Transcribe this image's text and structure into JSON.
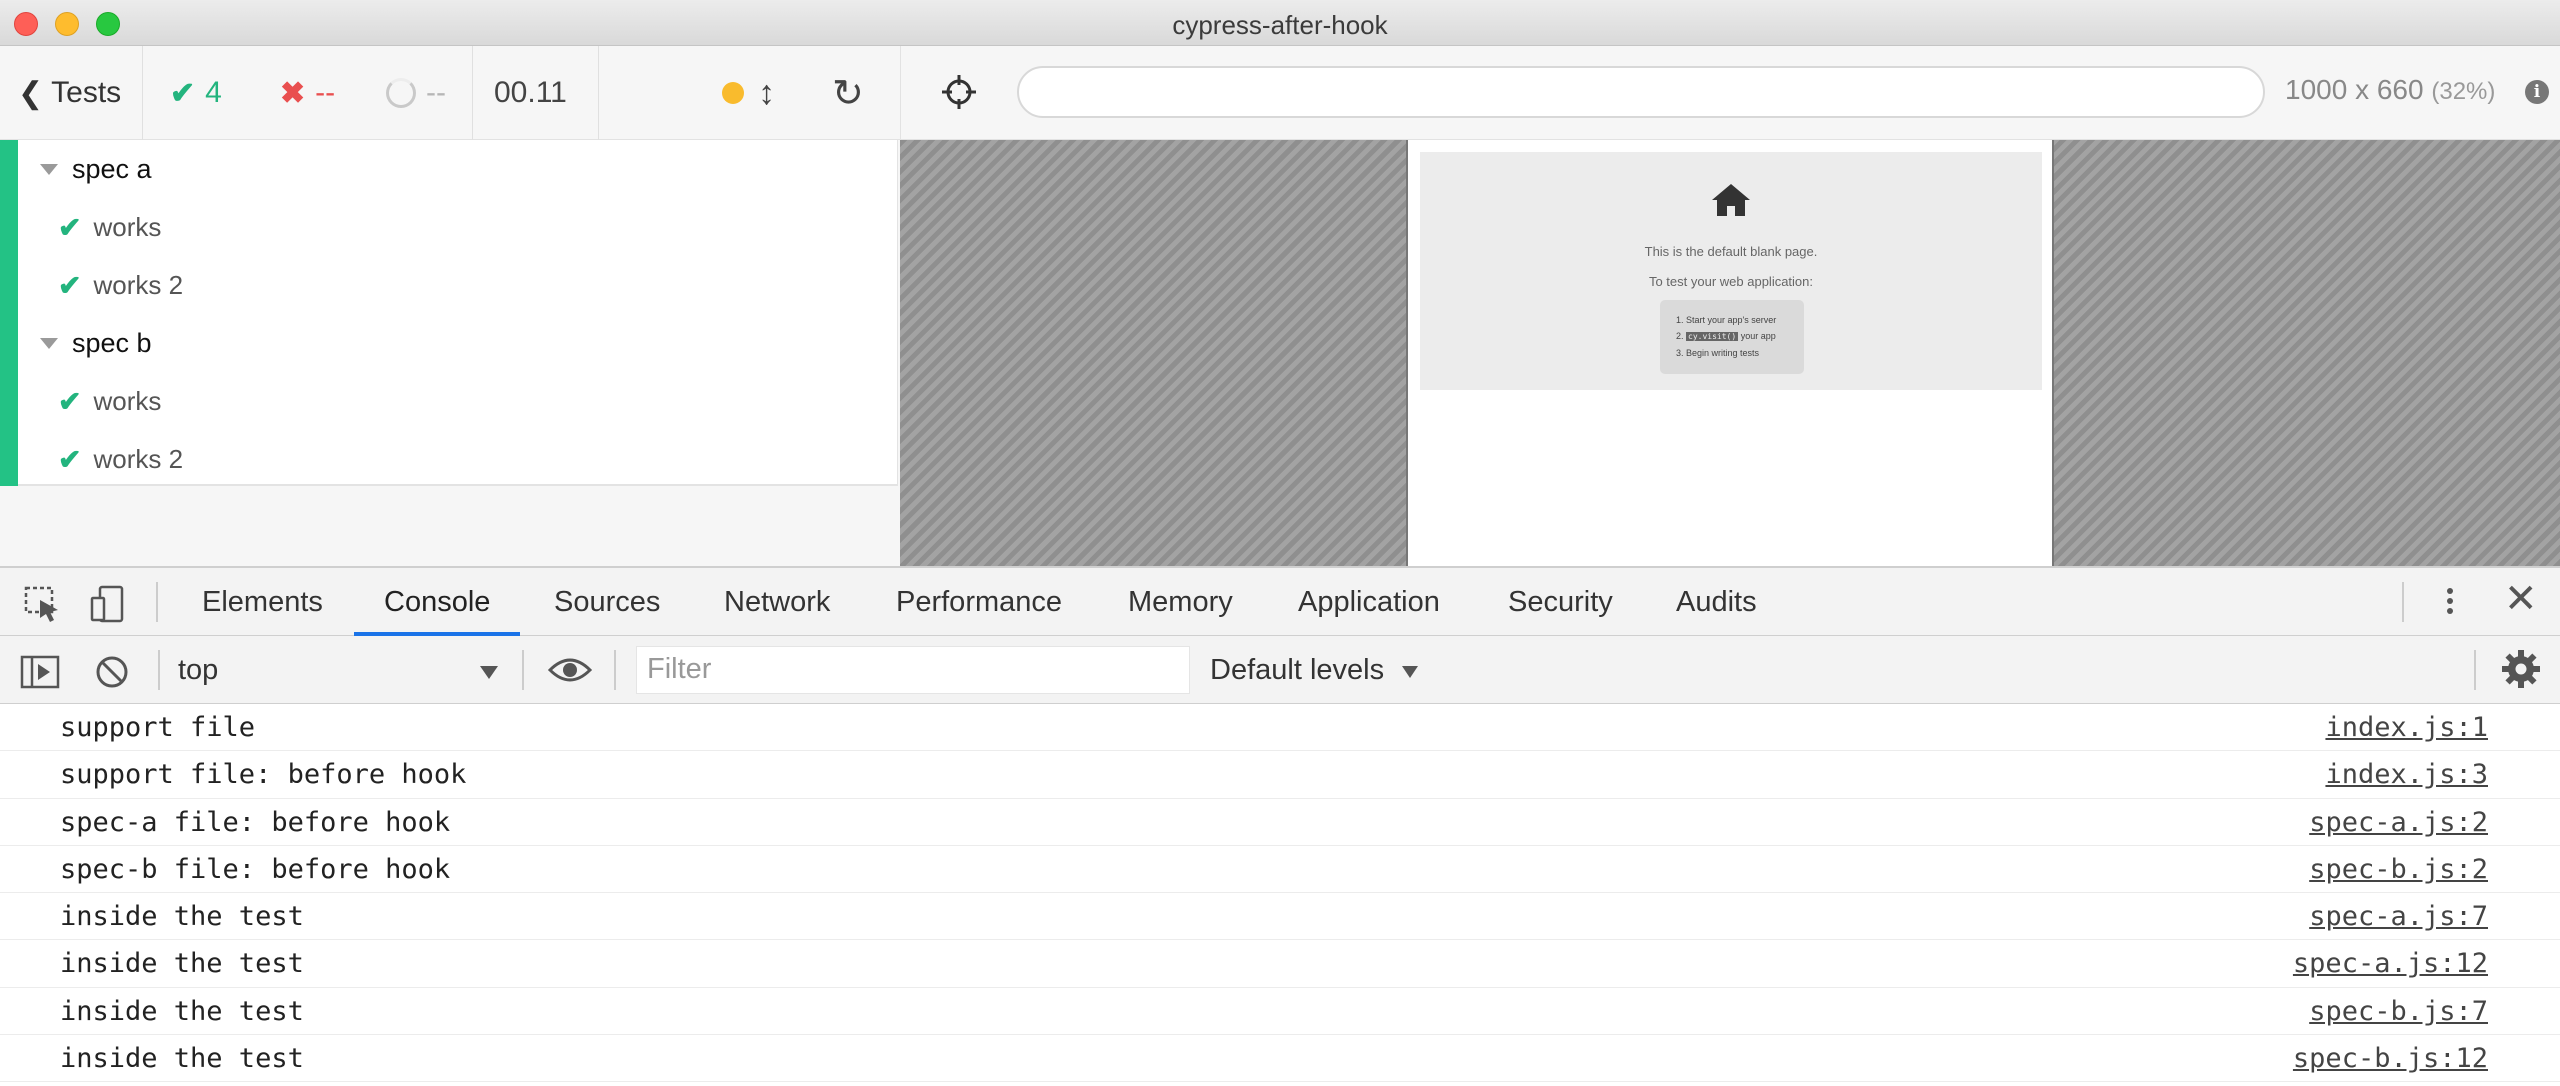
{
  "window": {
    "title": "cypress-after-hook"
  },
  "reporter": {
    "tests_label": "Tests",
    "passed_count": "4",
    "failed_count": "--",
    "pending_count": "--",
    "duration": "00.11",
    "suites": [
      {
        "title": "spec a",
        "tests": [
          {
            "title": "works"
          },
          {
            "title": "works 2"
          }
        ]
      },
      {
        "title": "spec b",
        "tests": [
          {
            "title": "works"
          },
          {
            "title": "works 2"
          }
        ]
      }
    ]
  },
  "aut": {
    "url": "",
    "viewport": "1000 x 660",
    "scale": "(32%)",
    "blank_page": {
      "line1": "This is the default blank page.",
      "line2": "To test your web application:",
      "step1": "1. Start your app's server",
      "step2_prefix": "2. ",
      "step2_code": "cy.visit()",
      "step2_suffix": " your app",
      "step3": "3. Begin writing tests"
    }
  },
  "devtools": {
    "tabs": [
      "Elements",
      "Console",
      "Sources",
      "Network",
      "Performance",
      "Memory",
      "Application",
      "Security",
      "Audits"
    ],
    "active_tab": "Console",
    "context": "top",
    "filter_placeholder": "Filter",
    "levels": "Default levels",
    "logs": [
      {
        "message": "support file",
        "source": "index.js:1"
      },
      {
        "message": "support file: before hook",
        "source": "index.js:3"
      },
      {
        "message": "spec-a file: before hook",
        "source": "spec-a.js:2"
      },
      {
        "message": "spec-b file: before hook",
        "source": "spec-b.js:2"
      },
      {
        "message": "inside the test",
        "source": "spec-a.js:7"
      },
      {
        "message": "inside the test",
        "source": "spec-a.js:12"
      },
      {
        "message": "inside the test",
        "source": "spec-b.js:7"
      },
      {
        "message": "inside the test",
        "source": "spec-b.js:12"
      }
    ]
  }
}
